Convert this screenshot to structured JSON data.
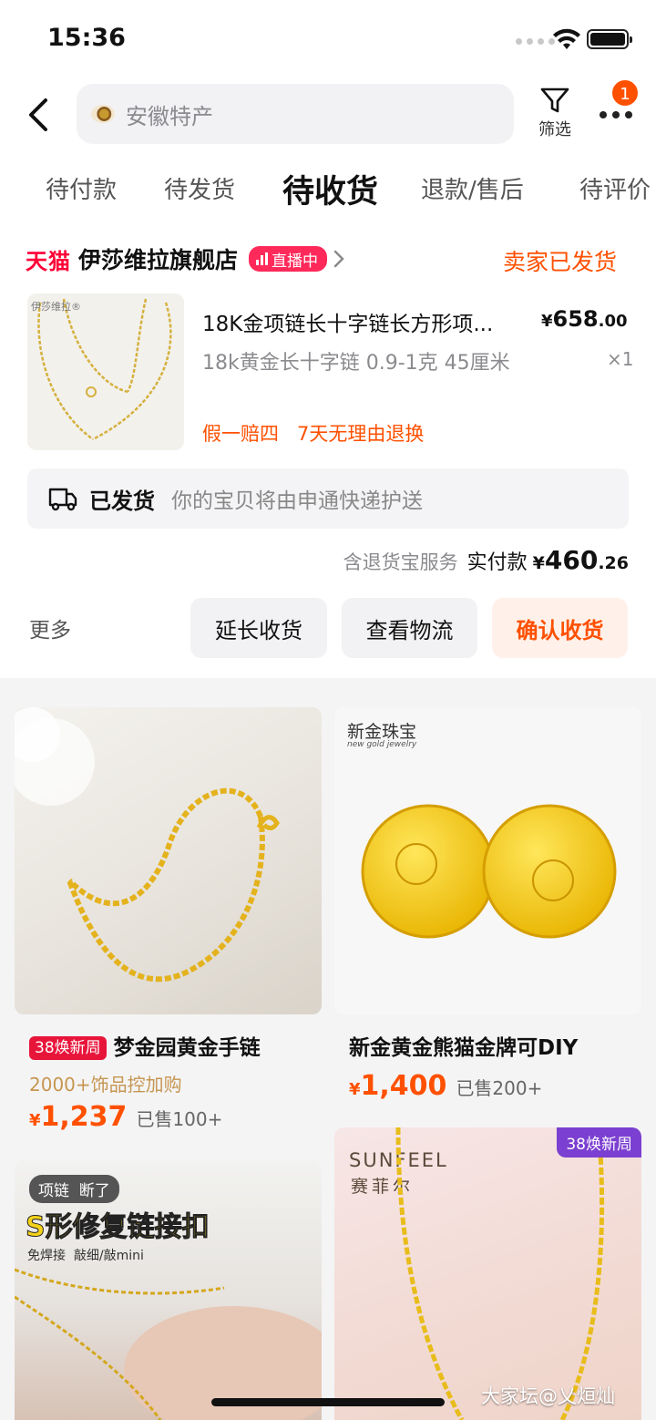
{
  "status_bar": {
    "time": "15:36"
  },
  "search": {
    "text": "安徽特产",
    "thumb_icon": "product-thumbnail"
  },
  "header": {
    "filter_label": "筛选",
    "notification_count": "1"
  },
  "tabs": [
    {
      "label": "待付款",
      "active": false
    },
    {
      "label": "待发货",
      "active": false
    },
    {
      "label": "待收货",
      "active": true
    },
    {
      "label": "退款/售后",
      "active": false
    },
    {
      "label": "待评价",
      "active": false
    }
  ],
  "order": {
    "platform": "天猫",
    "shop_name": "伊莎维拉旗舰店",
    "live_badge": "直播中",
    "status": "卖家已发货",
    "product": {
      "brand_mark": "伊莎维拉®",
      "title": "18K金项链长十字链长方形项...",
      "price_symbol": "¥",
      "price_int": "658",
      "price_dec": ".00",
      "sku": "18k黄金长十字链 0.9-1克 45厘米",
      "quantity": "×1",
      "guarantees": "假一赔四   7天无理由退换"
    },
    "logistics": {
      "title": "已发货",
      "text": "你的宝贝将由申通快递护送"
    },
    "payment": {
      "service": "含退货宝服务",
      "label": "实付款",
      "symbol": "¥",
      "amount_int": "460",
      "amount_dec": ".26"
    },
    "actions": {
      "more": "更多",
      "extend": "延长收货",
      "track": "查看物流",
      "confirm": "确认收货"
    }
  },
  "feed": [
    {
      "promo": "38焕新周",
      "title": "梦金园黄金手链",
      "subtitle": "2000+饰品控加购",
      "price_symbol": "¥",
      "price": "1,237",
      "sold": "已售100+"
    },
    {
      "brand": "新金珠宝",
      "brand_en": "new gold jewelry",
      "title": "新金黄金熊猫金牌可DIY",
      "price_symbol": "¥",
      "price": "1,400",
      "sold": "已售200+"
    },
    {
      "banner_top": "项链  断了",
      "banner_main": "S形修复链接扣",
      "banner_sub": "免焊接  敲细/敲mini"
    },
    {
      "corner": "38焕新周",
      "brand_en": "SUNFEEL",
      "brand_cn": "赛菲尔"
    }
  ],
  "watermark": "大家坛@乂烜灿",
  "colors": {
    "accent": "#ff5000",
    "tmall": "#ff0036",
    "live": "#ff2a5a",
    "promo": "#e8153b"
  }
}
